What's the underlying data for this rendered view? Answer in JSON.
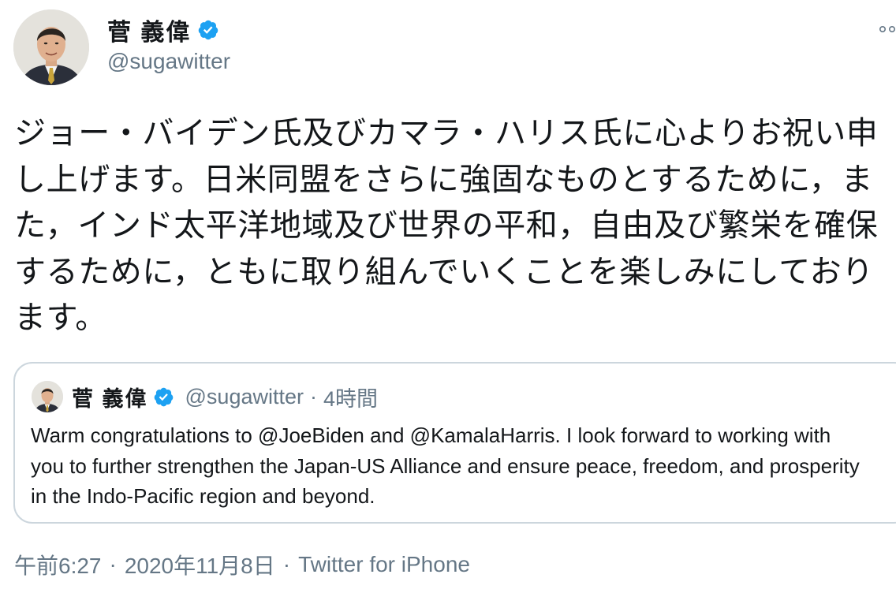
{
  "author": {
    "display_name": "菅 義偉",
    "handle": "@sugawitter",
    "verified_icon": "verified-badge-icon"
  },
  "tweet": {
    "text": "ジョー・バイデン氏及びカマラ・ハリス氏に心よりお祝い申し上げます。日米同盟をさらに強固なものとするために，また，インド太平洋地域及び世界の平和，自由及び繁栄を確保するために，ともに取り組んでいくことを楽しみにしております。"
  },
  "quoted_tweet": {
    "display_name": "菅 義偉",
    "handle": "@sugawitter",
    "separator": "·",
    "time": "4時間",
    "text": "Warm congratulations to @JoeBiden and @KamalaHarris. I look forward to working with you to further strengthen the Japan-US Alliance and ensure peace, freedom, and prosperity in the Indo-Pacific region and beyond."
  },
  "footer": {
    "time": "午前6:27",
    "separator": "·",
    "date": "2020年11月8日",
    "separator2": "·",
    "source": "Twitter for iPhone"
  },
  "colors": {
    "verified_blue": "#1da1f2",
    "secondary_text": "#657786",
    "primary_text": "#14171a",
    "border": "#ccd6dd"
  }
}
